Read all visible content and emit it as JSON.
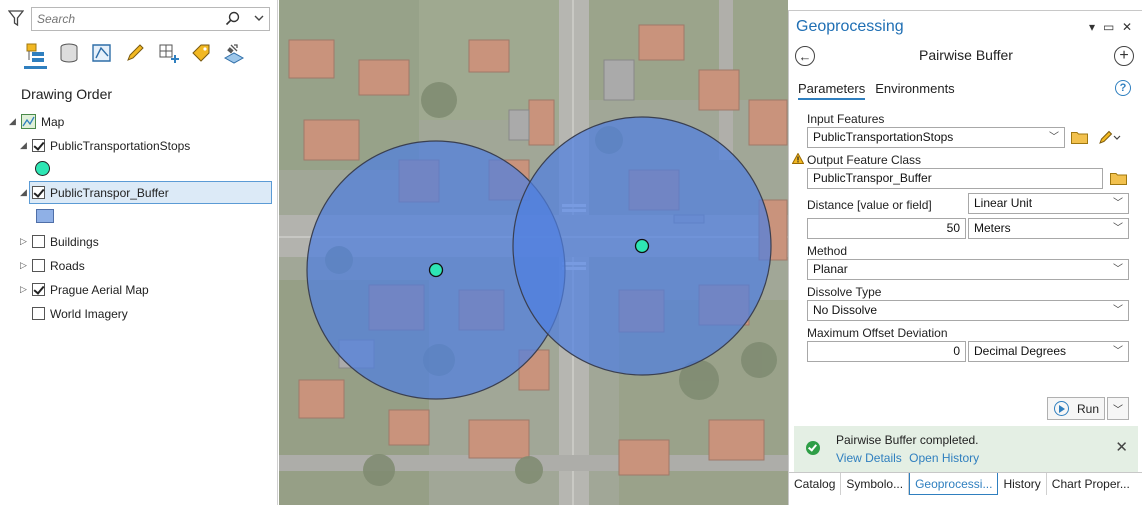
{
  "contents": {
    "search_placeholder": "Search",
    "tools": [
      "list-by-drawing-order-icon",
      "list-by-source-icon",
      "list-by-selection-icon",
      "list-by-editing-icon",
      "list-by-snapping-icon",
      "list-by-labeling-icon",
      "list-by-perspective-imagery-icon"
    ],
    "section_title": "Drawing Order",
    "map_label": "Map",
    "layers": [
      {
        "label": "PublicTransportationStops",
        "checked": true,
        "expanded": true
      },
      {
        "label": "PublicTranspor_Buffer",
        "checked": true,
        "expanded": true,
        "selected": true
      },
      {
        "label": "Buildings",
        "checked": false,
        "expanded": false
      },
      {
        "label": "Roads",
        "checked": false,
        "expanded": false
      },
      {
        "label": "Prague Aerial Map",
        "checked": true,
        "expanded": false
      },
      {
        "label": "World Imagery",
        "checked": false,
        "expanded": false
      }
    ],
    "stop_symbol_color": "#2ee6b4",
    "buffer_symbol_color": "#8fb0e6"
  },
  "map": {
    "buffer_color": "#4f7fe0",
    "stop_color": "#2ee6b4"
  },
  "geoprocessing": {
    "pane_title": "Geoprocessing",
    "tool_title": "Pairwise Buffer",
    "tabs": [
      "Parameters",
      "Environments"
    ],
    "input_features_label": "Input Features",
    "input_features_value": "PublicTransportationStops",
    "output_label": "Output Feature Class",
    "output_value": "PublicTranspor_Buffer",
    "distance_label": "Distance [value or field]",
    "distance_type": "Linear Unit",
    "distance_value": "50",
    "distance_unit": "Meters",
    "method_label": "Method",
    "method_value": "Planar",
    "dissolve_label": "Dissolve Type",
    "dissolve_value": "No Dissolve",
    "offset_label": "Maximum Offset Deviation",
    "offset_value": "0",
    "offset_unit": "Decimal Degrees",
    "run_label": "Run",
    "message": "Pairwise Buffer completed.",
    "view_details": "View Details",
    "open_history": "Open History"
  },
  "bottom_tabs": [
    "Catalog",
    "Symbolo...",
    "Geoprocessi...",
    "History",
    "Chart Proper..."
  ]
}
